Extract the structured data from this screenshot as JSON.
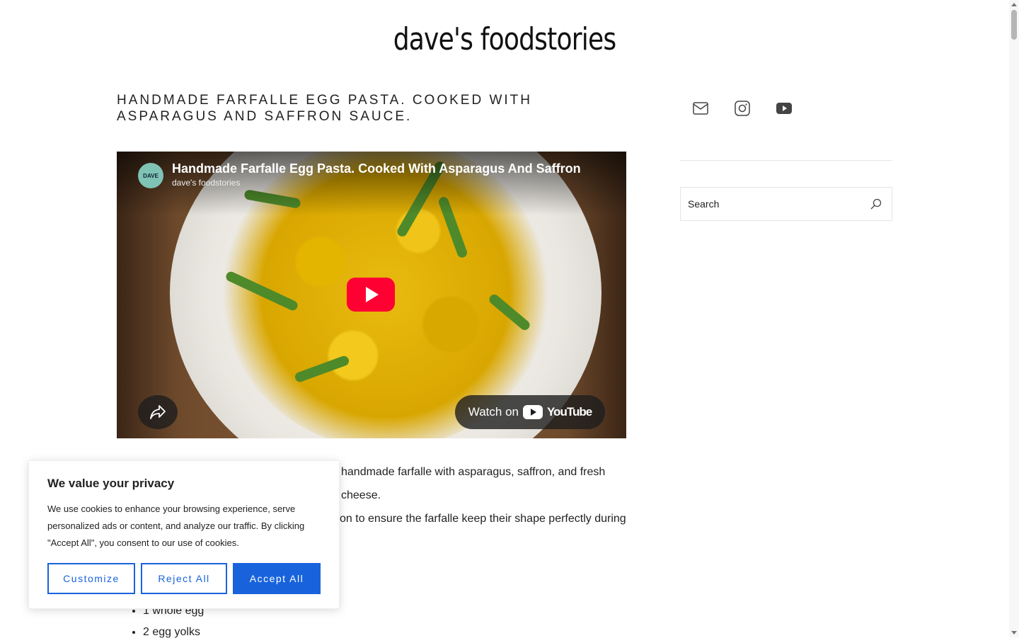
{
  "site": {
    "title": "dave's foodstories"
  },
  "post": {
    "title": "Handmade Farfalle Egg Pasta. Cooked With Asparagus and Saffron Sauce.",
    "body_line_1": "handmade farfalle with asparagus, saffron, and fresh cheese.",
    "body_line_2": "on to ensure the farfalle keep their shape perfectly during",
    "ingredients": [
      "1 whole egg",
      "2 egg yolks"
    ]
  },
  "video": {
    "title": "Handmade Farfalle Egg Pasta. Cooked With Asparagus And Saffron",
    "channel": "dave's foodstories",
    "channel_logo_text": "DAVE",
    "watch_on_label": "Watch on",
    "youtube_word": "YouTube"
  },
  "sidebar": {
    "social_icons": [
      "mail-icon",
      "instagram-icon",
      "youtube-icon"
    ],
    "search_placeholder": "Search"
  },
  "cookie_banner": {
    "heading": "We value your privacy",
    "text": "We use cookies to enhance your browsing experience, serve personalized ads or content, and analyze our traffic. By clicking \"Accept All\", you consent to our use of cookies.",
    "customize_label": "Customize",
    "reject_label": "Reject All",
    "accept_label": "Accept All"
  },
  "colors": {
    "accent": "#1863dc",
    "youtube_red": "#ff0033"
  }
}
